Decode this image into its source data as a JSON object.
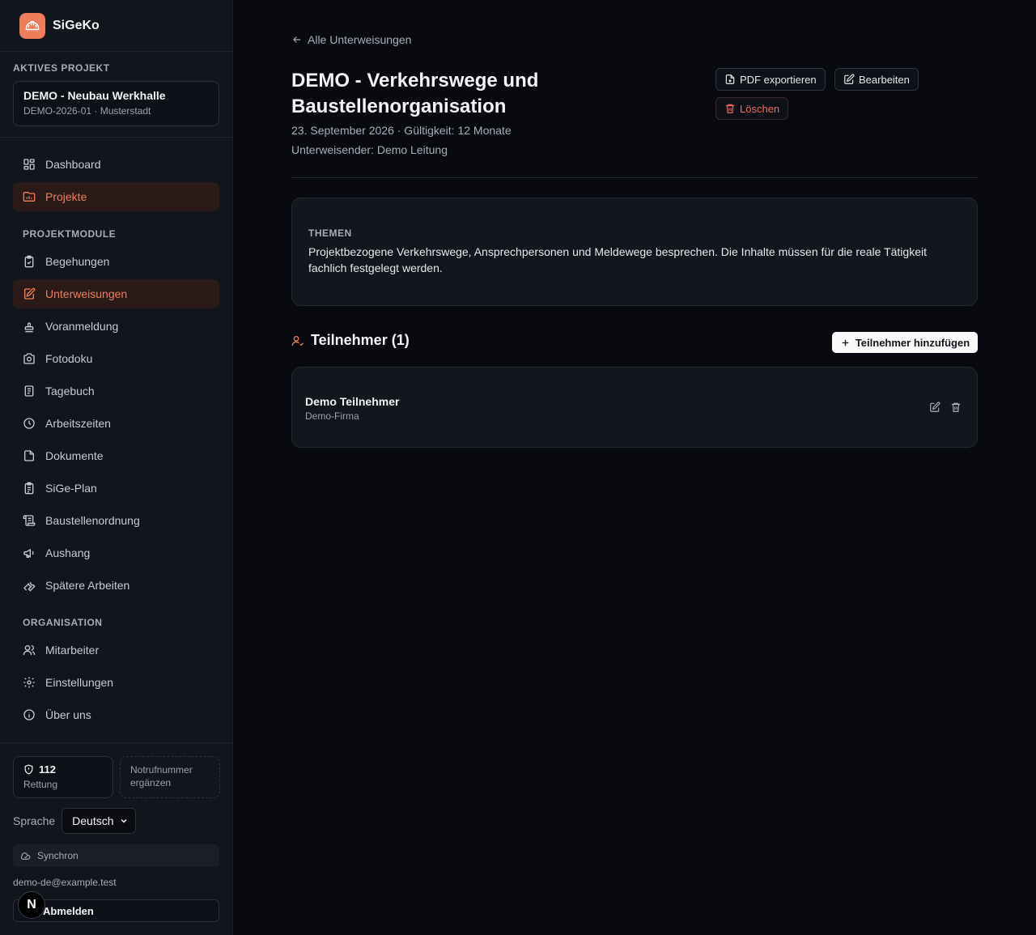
{
  "app": {
    "name": "SiGeKo"
  },
  "sidebar": {
    "active_project_label": "Aktives Projekt",
    "project": {
      "title": "DEMO - Neubau Werkhalle",
      "subtitle": "DEMO-2026-01 · Musterstadt"
    },
    "main_nav": [
      {
        "label": "Dashboard",
        "icon": "dashboard-icon",
        "active": false
      },
      {
        "label": "Projekte",
        "icon": "folder-icon",
        "active": true
      }
    ],
    "modules_label": "Projektmodule",
    "modules": [
      {
        "label": "Begehungen",
        "icon": "clipboard-check-icon",
        "active": false
      },
      {
        "label": "Unterweisungen",
        "icon": "edit-document-icon",
        "active": true
      },
      {
        "label": "Voranmeldung",
        "icon": "stamp-icon",
        "active": false
      },
      {
        "label": "Fotodoku",
        "icon": "camera-icon",
        "active": false
      },
      {
        "label": "Tagebuch",
        "icon": "book-icon",
        "active": false
      },
      {
        "label": "Arbeitszeiten",
        "icon": "clock-icon",
        "active": false
      },
      {
        "label": "Dokumente",
        "icon": "file-icon",
        "active": false
      },
      {
        "label": "SiGe-Plan",
        "icon": "clipboard-list-icon",
        "active": false
      },
      {
        "label": "Baustellenordnung",
        "icon": "scroll-icon",
        "active": false
      },
      {
        "label": "Aushang",
        "icon": "megaphone-icon",
        "active": false
      },
      {
        "label": "Spätere Arbeiten",
        "icon": "wrench-icon",
        "active": false
      }
    ],
    "org_label": "Organisation",
    "org": [
      {
        "label": "Mitarbeiter",
        "icon": "users-icon",
        "active": false
      },
      {
        "label": "Einstellungen",
        "icon": "gear-icon",
        "active": false
      },
      {
        "label": "Über uns",
        "icon": "info-icon",
        "active": false
      }
    ],
    "emergency": {
      "number": "112",
      "label": "Rettung",
      "add_text": "Notrufnummer ergänzen"
    },
    "language": {
      "label": "Sprache",
      "value": "Deutsch"
    },
    "sync": "Synchron",
    "email": "demo-de@example.test",
    "logout": "Abmelden",
    "badge": "N"
  },
  "main": {
    "back_link": "Alle Unterweisungen",
    "title": "DEMO - Verkehrswege und Baustellenorganisation",
    "date_line": "23. September 2026 · Gültigkeit: 12 Monate",
    "instructor_line": "Unterweisender: Demo Leitung",
    "actions": {
      "pdf": "PDF exportieren",
      "edit": "Bearbeiten",
      "delete": "Löschen"
    },
    "themes": {
      "label": "Themen",
      "text": "Projektbezogene Verkehrswege, Ansprechpersonen und Meldewege besprechen. Die Inhalte müssen für die reale Tätigkeit fachlich festgelegt werden."
    },
    "participants": {
      "heading": "Teilnehmer (1)",
      "add_button": "Teilnehmer hinzufügen",
      "items": [
        {
          "name": "Demo Teilnehmer",
          "company": "Demo-Firma"
        }
      ]
    }
  },
  "colors": {
    "accent": "#ee7e59",
    "danger": "#ec6c5e",
    "background": "#080a10",
    "sidebar": "#12151c"
  }
}
